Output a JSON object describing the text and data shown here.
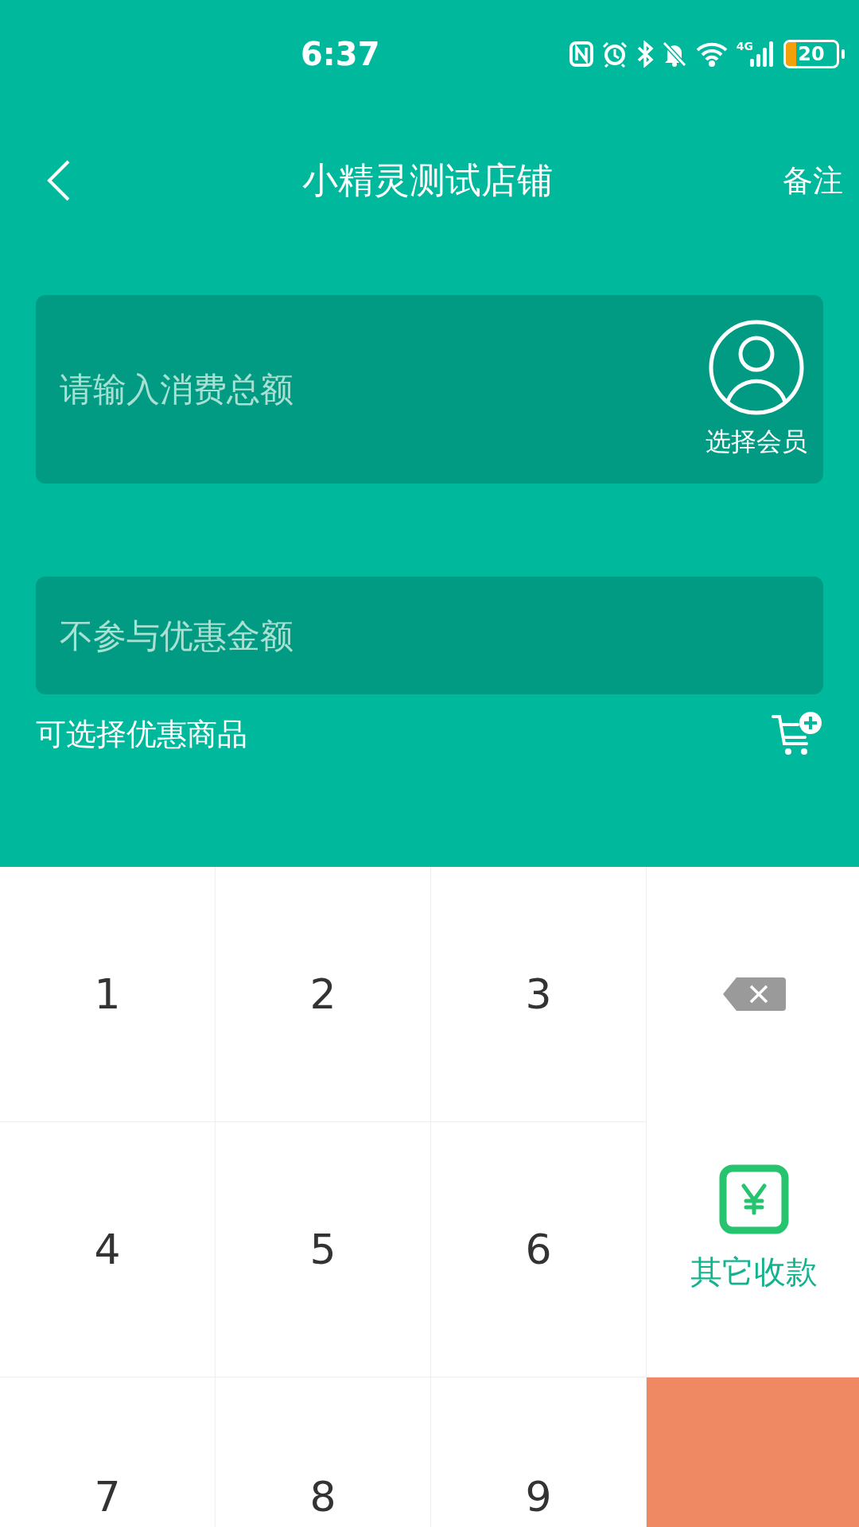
{
  "status_bar": {
    "time": "6:37",
    "network": "4G",
    "battery": {
      "level": 0.2,
      "text": "20"
    }
  },
  "header": {
    "title": "小精灵测试店铺",
    "action": "备注"
  },
  "amount_field": {
    "placeholder": "请输入消费总额"
  },
  "member_button": {
    "label": "选择会员"
  },
  "excluded_field": {
    "placeholder": "不参与优惠金额"
  },
  "discount_link": {
    "label": "可选择优惠商品"
  },
  "keypad": {
    "keys": [
      "1",
      "2",
      "3",
      "4",
      "5",
      "6",
      "7",
      "8",
      "9"
    ],
    "other_payment": "其它收款"
  }
}
